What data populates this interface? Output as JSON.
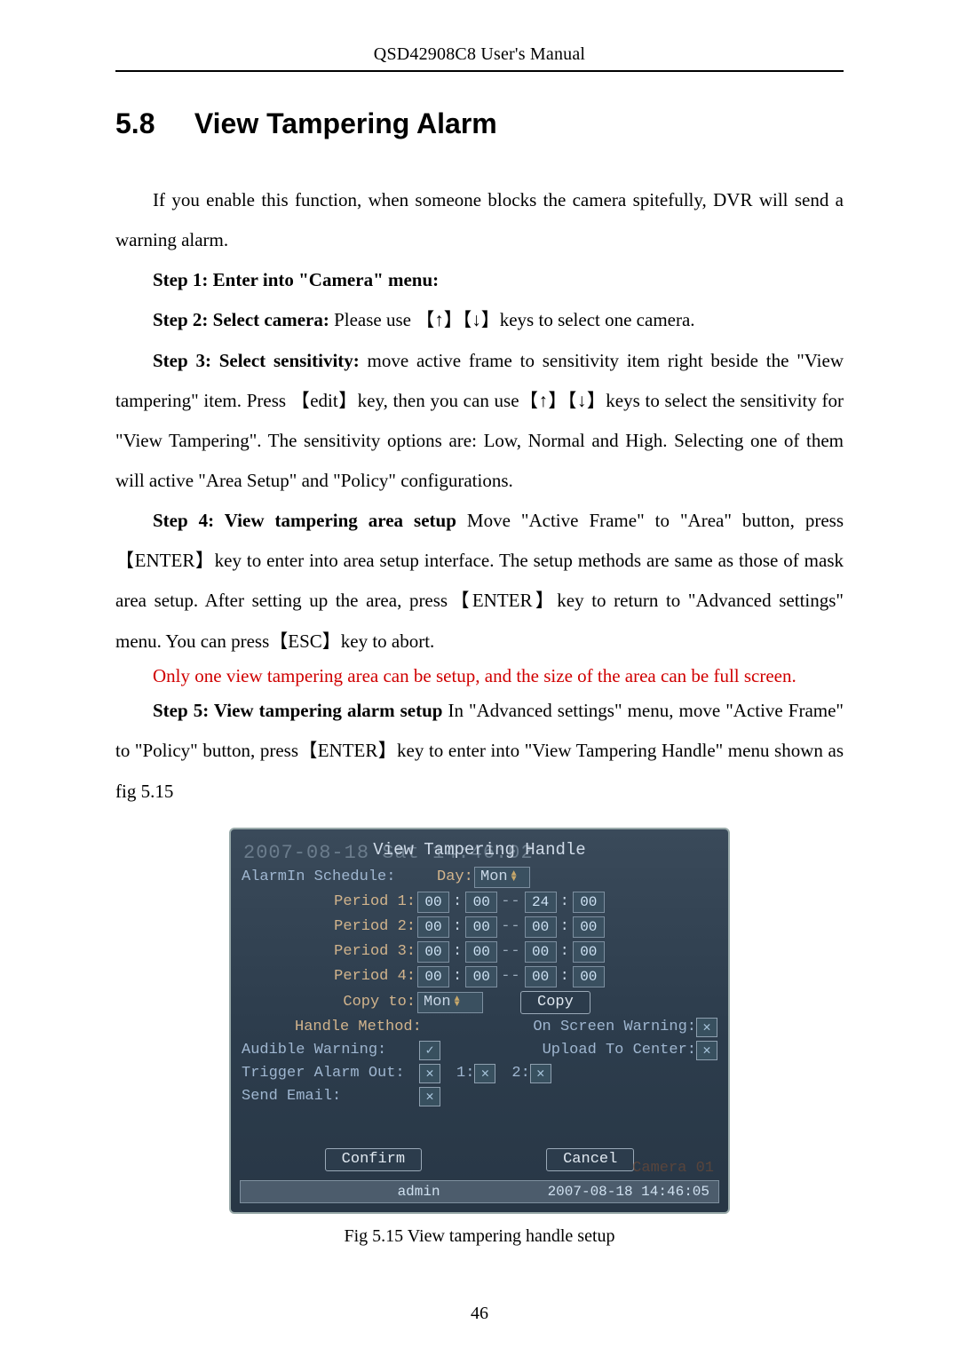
{
  "header": {
    "running": "QSD42908C8 User's Manual"
  },
  "section": {
    "number": "5.8",
    "title": "View Tampering Alarm"
  },
  "body": {
    "intro": "If you enable this function, when someone blocks the camera spitefully, DVR will send a warning alarm.",
    "step1": "Step 1: Enter into \"Camera\" menu:",
    "step2_lead": "Step 2: Select camera: ",
    "step2_text": "Please use 【↑】【↓】keys to select one camera.",
    "step3_lead": "Step 3: Select sensitivity: ",
    "step3_text": "move active frame to sensitivity item right beside the \"View tampering\" item. Press  【edit】key, then you can use【↑】【↓】keys to select the sensitivity for \"View Tampering\". The sensitivity options are: Low, Normal and High. Selecting one of them will active \"Area Setup\" and \"Policy\" configurations.",
    "step4_lead": "Step 4: View tampering area setup ",
    "step4_text": "Move \"Active Frame\" to \"Area\" button, press 【ENTER】key to enter into area setup interface. The setup methods are same as those of mask area setup. After setting up the area, press【ENTER】key to return to \"Advanced settings\" menu. You can press【ESC】key to abort.",
    "red_note": "Only one view tampering area can be setup, and the size of the area can be full screen.",
    "step5_lead": "Step 5: View tampering alarm setup ",
    "step5_text": "In \"Advanced settings\" menu, move \"Active Frame\" to \"Policy\" button, press【ENTER】key to enter into \"View Tampering Handle\" menu shown as fig 5.15"
  },
  "dvr": {
    "bg_time": "2007-08-18 Sat 14:46:02",
    "title": "View Tampering Handle",
    "schedule_label": "AlarmIn Schedule:",
    "day_label": "Day:",
    "day_value": "Mon",
    "periods": [
      {
        "label": "Period 1:",
        "a": "00",
        "b": "00",
        "c": "24",
        "d": "00"
      },
      {
        "label": "Period 2:",
        "a": "00",
        "b": "00",
        "c": "00",
        "d": "00"
      },
      {
        "label": "Period 3:",
        "a": "00",
        "b": "00",
        "c": "00",
        "d": "00"
      },
      {
        "label": "Period 4:",
        "a": "00",
        "b": "00",
        "c": "00",
        "d": "00"
      }
    ],
    "copy_to_label": "Copy to:",
    "copy_to_value": "Mon",
    "copy_button": "Copy",
    "handle_method_label": "Handle Method:",
    "opts": {
      "on_screen": "On Screen Warning:",
      "audible": "Audible Warning:",
      "upload": "Upload To Center:",
      "trigger": "Trigger Alarm Out:",
      "out1": "1:",
      "out2": "2:",
      "send_email": "Send Email:"
    },
    "checks": {
      "on_screen": "✕",
      "audible": "✓",
      "upload": "✕",
      "trigger": "✕",
      "out1": "✕",
      "out2": "✕",
      "send_email": "✕"
    },
    "confirm": "Confirm",
    "cancel": "Cancel",
    "watermark": "Camera 01",
    "status": {
      "user": "admin",
      "time": "2007-08-18 14:46:05"
    }
  },
  "caption": "Fig 5.15 View tampering handle setup",
  "page_number": "46"
}
